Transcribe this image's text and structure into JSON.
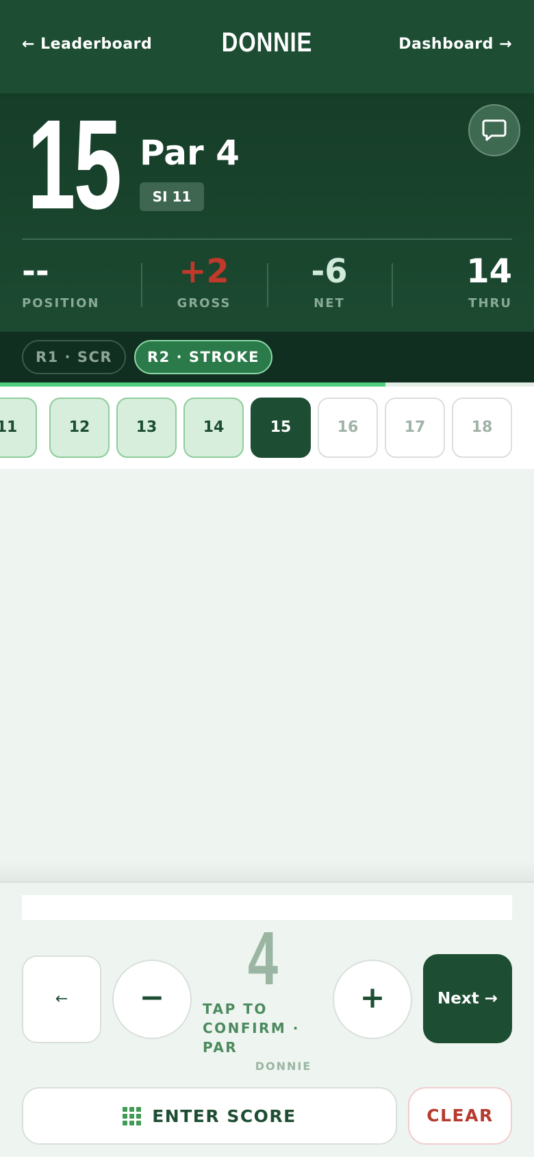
{
  "nav": {
    "back_label": "← Leaderboard",
    "title": "DONNIE",
    "forward_label": "Dashboard →"
  },
  "hole": {
    "number": "15",
    "par": "Par 4",
    "stroke_index": "SI 11"
  },
  "stats": {
    "position": {
      "value": "--",
      "label": "POSITION"
    },
    "gross": {
      "value": "+2",
      "label": "GROSS",
      "color": "#c0392b"
    },
    "net": {
      "value": "-6",
      "label": "NET",
      "color": "#cfeadb"
    },
    "thru": {
      "value": "14",
      "label": "THRU"
    }
  },
  "rounds": [
    {
      "label": "R1 · SCR",
      "active": false
    },
    {
      "label": "R2 · STROKE",
      "active": true
    }
  ],
  "progress": {
    "fraction": 0.722
  },
  "holes": [
    {
      "label": "11",
      "state": "played"
    },
    {
      "label": "12",
      "state": "played"
    },
    {
      "label": "13",
      "state": "played"
    },
    {
      "label": "14",
      "state": "played"
    },
    {
      "label": "15",
      "state": "current"
    },
    {
      "label": "16",
      "state": "future"
    },
    {
      "label": "17",
      "state": "future"
    },
    {
      "label": "18",
      "state": "future"
    }
  ],
  "scorer": {
    "prev_label": "←",
    "minus_label": "−",
    "score": "4",
    "confirm_text": "TAP TO CONFIRM · PAR",
    "player": "DONNIE",
    "plus_label": "+",
    "next_label": "Next →"
  },
  "actions": {
    "enter_score": "ENTER SCORE",
    "clear": "CLEAR"
  },
  "icons": {
    "chat": "chat-bubble-icon",
    "grid": "keypad-grid-icon"
  },
  "colors": {
    "brand_dark": "#1d4d33",
    "accent_green": "#4fcf7e",
    "danger": "#b63a2e"
  }
}
